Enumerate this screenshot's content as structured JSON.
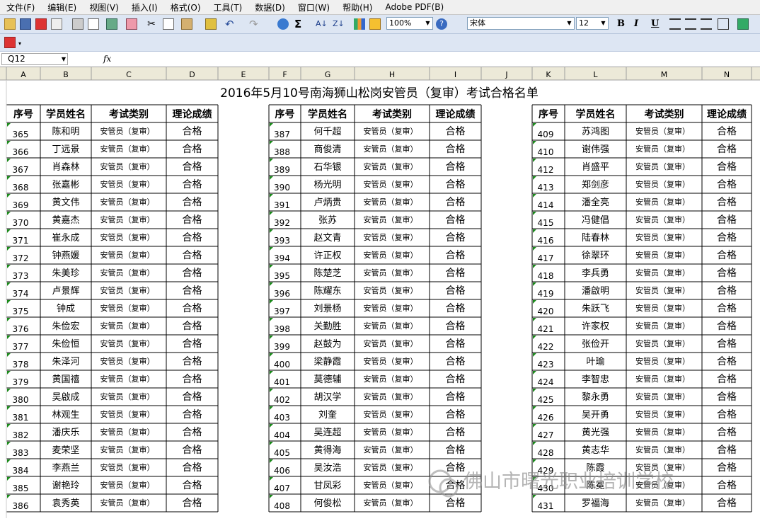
{
  "menus": [
    "文件(F)",
    "编辑(E)",
    "视图(V)",
    "插入(I)",
    "格式(O)",
    "工具(T)",
    "数据(D)",
    "窗口(W)",
    "帮助(H)",
    "Adobe PDF(B)"
  ],
  "toolbar": {
    "zoom": "100%",
    "font_name": "宋体",
    "font_size": "12"
  },
  "formula_bar": {
    "name_box": "Q12",
    "fx": "fx",
    "content": ""
  },
  "sheet": {
    "title": "2016年5月10号南海狮山松岗安管员（复审）考试合格名单",
    "headers": [
      "序号",
      "学员姓名",
      "考试类别",
      "理论成绩"
    ],
    "exam_type": "安管员（复审）",
    "result": "合格",
    "watermark": "佛山市曙光职业培训学校",
    "col_letters": [
      "A",
      "B",
      "C",
      "D",
      "E",
      "F",
      "G",
      "H",
      "I",
      "J",
      "K",
      "L",
      "M",
      "N"
    ],
    "groups": [
      {
        "ids": [
          "365",
          "366",
          "367",
          "368",
          "369",
          "370",
          "371",
          "372",
          "373",
          "374",
          "375",
          "376",
          "377",
          "378",
          "379",
          "380",
          "381",
          "382",
          "383",
          "384",
          "385",
          "386"
        ],
        "names": [
          "陈和明",
          "丁远景",
          "肖森林",
          "张嘉彬",
          "黄文伟",
          "黄嘉杰",
          "崔永成",
          "钟燕媛",
          "朱美珍",
          "卢景辉",
          "钟成",
          "朱俭宏",
          "朱俭恒",
          "朱泽河",
          "黄国禧",
          "吴啟成",
          "林观生",
          "潘庆乐",
          "麦荣坚",
          "李燕兰",
          "谢艳玲",
          "袁秀英"
        ]
      },
      {
        "ids": [
          "387",
          "388",
          "389",
          "390",
          "391",
          "392",
          "393",
          "394",
          "395",
          "396",
          "397",
          "398",
          "399",
          "400",
          "401",
          "402",
          "403",
          "404",
          "405",
          "406",
          "407",
          "408"
        ],
        "names": [
          "何千超",
          "商俊清",
          "石华银",
          "杨光明",
          "卢炳贵",
          "张苏",
          "赵文青",
          "许正权",
          "陈楚芝",
          "陈耀东",
          "刘景杨",
          "关勤胜",
          "赵鼓为",
          "梁静霞",
          "莫德辅",
          "胡汉学",
          "刘奎",
          "吴连超",
          "黄得海",
          "吴汝浩",
          "甘凤彩",
          "何俊松"
        ]
      },
      {
        "ids": [
          "409",
          "410",
          "412",
          "413",
          "414",
          "415",
          "416",
          "417",
          "418",
          "419",
          "420",
          "421",
          "422",
          "423",
          "424",
          "425",
          "426",
          "427",
          "428",
          "429",
          "430",
          "431"
        ],
        "names": [
          "苏鸿图",
          "谢伟强",
          "肖盛平",
          "郑剑彦",
          "潘全亮",
          "冯健倡",
          "陆春林",
          "徐翠环",
          "李兵勇",
          "潘啟明",
          "朱跃飞",
          "许家权",
          "张俭开",
          "叶瑜",
          "李智忠",
          "黎永勇",
          "吴开勇",
          "黄光强",
          "黄志华",
          "陈霞",
          "陈冕",
          "罗福海"
        ]
      }
    ]
  }
}
